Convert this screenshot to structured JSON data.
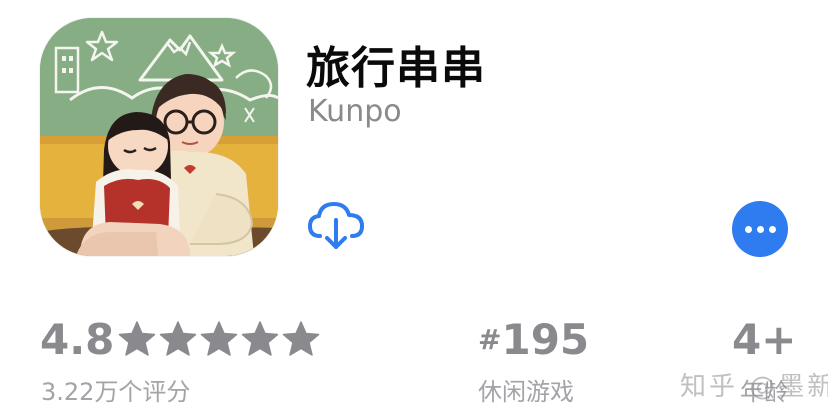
{
  "app": {
    "title": "旅行串串",
    "developer": "Kunpo"
  },
  "icons": {
    "app_icon": "app-icon-illustration",
    "download": "cloud-download-icon",
    "more": "ellipsis-icon",
    "star": "star-icon"
  },
  "stats": {
    "rating": {
      "value": "4.8",
      "stars": 4.8,
      "stars_max": 5,
      "count_label": "3.22万个评分"
    },
    "rank": {
      "hash": "#",
      "number": "195",
      "category": "休闲游戏"
    },
    "age": {
      "value": "4+",
      "label": "年龄"
    }
  },
  "watermark": {
    "text": "知乎 @墨新"
  },
  "colors": {
    "accent": "#2f7bf0",
    "title": "#0a0a0a",
    "secondary": "#8a8a8e"
  }
}
